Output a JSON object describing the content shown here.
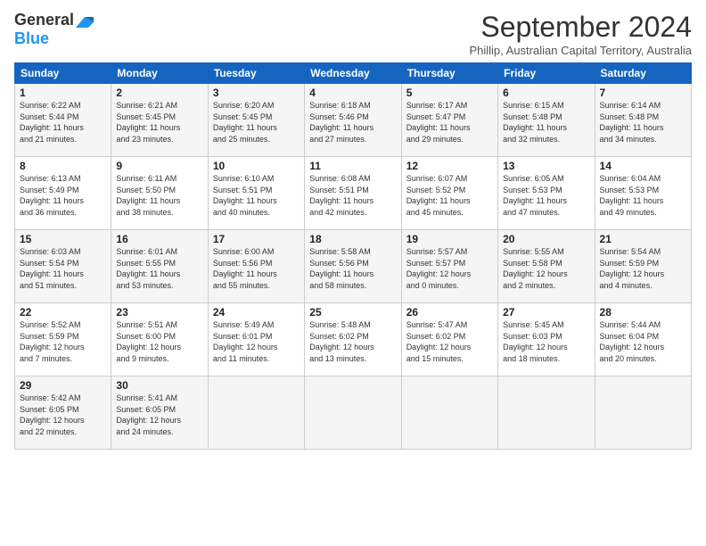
{
  "logo": {
    "general": "General",
    "blue": "Blue"
  },
  "title": "September 2024",
  "location": "Phillip, Australian Capital Territory, Australia",
  "headers": [
    "Sunday",
    "Monday",
    "Tuesday",
    "Wednesday",
    "Thursday",
    "Friday",
    "Saturday"
  ],
  "weeks": [
    [
      {
        "day": "1",
        "info": "Sunrise: 6:22 AM\nSunset: 5:44 PM\nDaylight: 11 hours\nand 21 minutes."
      },
      {
        "day": "2",
        "info": "Sunrise: 6:21 AM\nSunset: 5:45 PM\nDaylight: 11 hours\nand 23 minutes."
      },
      {
        "day": "3",
        "info": "Sunrise: 6:20 AM\nSunset: 5:45 PM\nDaylight: 11 hours\nand 25 minutes."
      },
      {
        "day": "4",
        "info": "Sunrise: 6:18 AM\nSunset: 5:46 PM\nDaylight: 11 hours\nand 27 minutes."
      },
      {
        "day": "5",
        "info": "Sunrise: 6:17 AM\nSunset: 5:47 PM\nDaylight: 11 hours\nand 29 minutes."
      },
      {
        "day": "6",
        "info": "Sunrise: 6:15 AM\nSunset: 5:48 PM\nDaylight: 11 hours\nand 32 minutes."
      },
      {
        "day": "7",
        "info": "Sunrise: 6:14 AM\nSunset: 5:48 PM\nDaylight: 11 hours\nand 34 minutes."
      }
    ],
    [
      {
        "day": "8",
        "info": "Sunrise: 6:13 AM\nSunset: 5:49 PM\nDaylight: 11 hours\nand 36 minutes."
      },
      {
        "day": "9",
        "info": "Sunrise: 6:11 AM\nSunset: 5:50 PM\nDaylight: 11 hours\nand 38 minutes."
      },
      {
        "day": "10",
        "info": "Sunrise: 6:10 AM\nSunset: 5:51 PM\nDaylight: 11 hours\nand 40 minutes."
      },
      {
        "day": "11",
        "info": "Sunrise: 6:08 AM\nSunset: 5:51 PM\nDaylight: 11 hours\nand 42 minutes."
      },
      {
        "day": "12",
        "info": "Sunrise: 6:07 AM\nSunset: 5:52 PM\nDaylight: 11 hours\nand 45 minutes."
      },
      {
        "day": "13",
        "info": "Sunrise: 6:05 AM\nSunset: 5:53 PM\nDaylight: 11 hours\nand 47 minutes."
      },
      {
        "day": "14",
        "info": "Sunrise: 6:04 AM\nSunset: 5:53 PM\nDaylight: 11 hours\nand 49 minutes."
      }
    ],
    [
      {
        "day": "15",
        "info": "Sunrise: 6:03 AM\nSunset: 5:54 PM\nDaylight: 11 hours\nand 51 minutes."
      },
      {
        "day": "16",
        "info": "Sunrise: 6:01 AM\nSunset: 5:55 PM\nDaylight: 11 hours\nand 53 minutes."
      },
      {
        "day": "17",
        "info": "Sunrise: 6:00 AM\nSunset: 5:56 PM\nDaylight: 11 hours\nand 55 minutes."
      },
      {
        "day": "18",
        "info": "Sunrise: 5:58 AM\nSunset: 5:56 PM\nDaylight: 11 hours\nand 58 minutes."
      },
      {
        "day": "19",
        "info": "Sunrise: 5:57 AM\nSunset: 5:57 PM\nDaylight: 12 hours\nand 0 minutes."
      },
      {
        "day": "20",
        "info": "Sunrise: 5:55 AM\nSunset: 5:58 PM\nDaylight: 12 hours\nand 2 minutes."
      },
      {
        "day": "21",
        "info": "Sunrise: 5:54 AM\nSunset: 5:59 PM\nDaylight: 12 hours\nand 4 minutes."
      }
    ],
    [
      {
        "day": "22",
        "info": "Sunrise: 5:52 AM\nSunset: 5:59 PM\nDaylight: 12 hours\nand 7 minutes."
      },
      {
        "day": "23",
        "info": "Sunrise: 5:51 AM\nSunset: 6:00 PM\nDaylight: 12 hours\nand 9 minutes."
      },
      {
        "day": "24",
        "info": "Sunrise: 5:49 AM\nSunset: 6:01 PM\nDaylight: 12 hours\nand 11 minutes."
      },
      {
        "day": "25",
        "info": "Sunrise: 5:48 AM\nSunset: 6:02 PM\nDaylight: 12 hours\nand 13 minutes."
      },
      {
        "day": "26",
        "info": "Sunrise: 5:47 AM\nSunset: 6:02 PM\nDaylight: 12 hours\nand 15 minutes."
      },
      {
        "day": "27",
        "info": "Sunrise: 5:45 AM\nSunset: 6:03 PM\nDaylight: 12 hours\nand 18 minutes."
      },
      {
        "day": "28",
        "info": "Sunrise: 5:44 AM\nSunset: 6:04 PM\nDaylight: 12 hours\nand 20 minutes."
      }
    ],
    [
      {
        "day": "29",
        "info": "Sunrise: 5:42 AM\nSunset: 6:05 PM\nDaylight: 12 hours\nand 22 minutes."
      },
      {
        "day": "30",
        "info": "Sunrise: 5:41 AM\nSunset: 6:05 PM\nDaylight: 12 hours\nand 24 minutes."
      },
      {
        "day": "",
        "info": ""
      },
      {
        "day": "",
        "info": ""
      },
      {
        "day": "",
        "info": ""
      },
      {
        "day": "",
        "info": ""
      },
      {
        "day": "",
        "info": ""
      }
    ]
  ]
}
